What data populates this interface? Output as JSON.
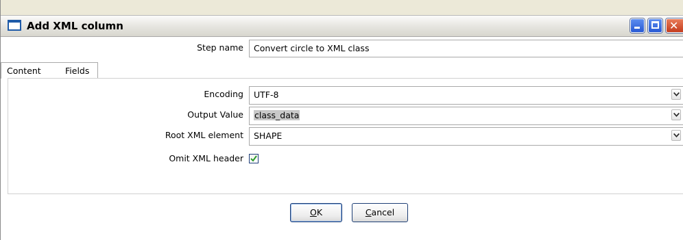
{
  "window": {
    "title": "Add XML column"
  },
  "step": {
    "label": "Step name",
    "value": "Convert circle to XML class"
  },
  "tabs": [
    {
      "label": "Content",
      "active": true
    },
    {
      "label": "Fields",
      "active": false
    }
  ],
  "content": {
    "encoding": {
      "label": "Encoding",
      "value": "UTF-8"
    },
    "output_value": {
      "label": "Output Value",
      "value": "class_data"
    },
    "root_element": {
      "label": "Root XML element",
      "value": "SHAPE"
    },
    "omit_header": {
      "label": "Omit XML header",
      "checked": true
    }
  },
  "buttons": {
    "ok": {
      "mnemonic": "O",
      "rest": "K"
    },
    "cancel": {
      "mnemonic": "C",
      "rest": "ancel"
    }
  },
  "colors": {
    "title_accent": "#1e5aa8",
    "check_green": "#2a9a2a",
    "close_button": "#c33c1d"
  },
  "icons": [
    "window-icon",
    "minimize-icon",
    "maximize-icon",
    "close-icon",
    "dropdown-arrow-icon",
    "checkmark-icon"
  ]
}
